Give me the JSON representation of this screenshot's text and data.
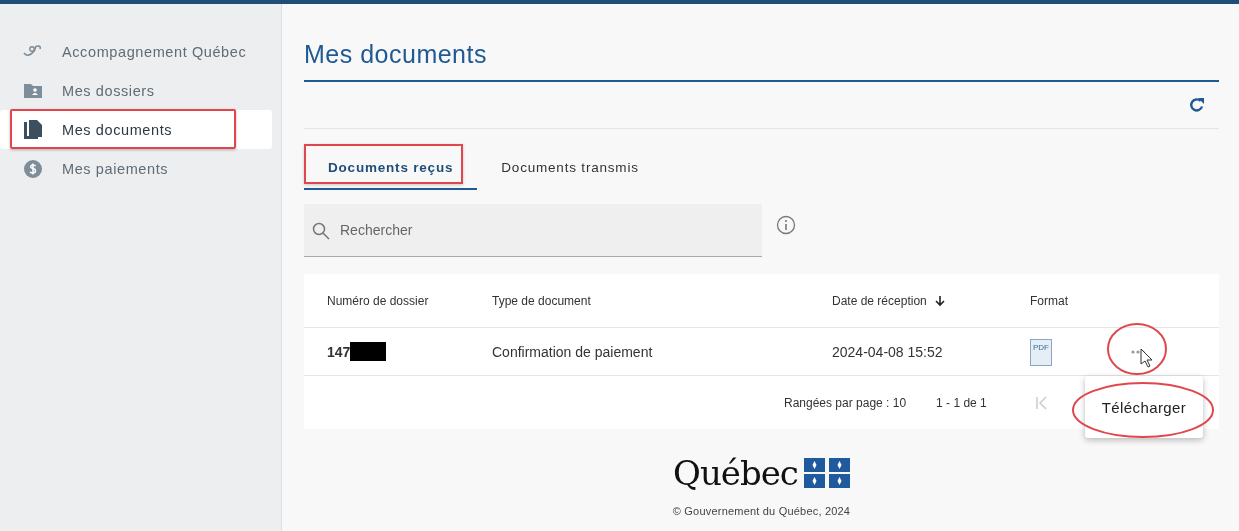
{
  "sidebar": {
    "items": [
      {
        "kind": "support",
        "label": "Accompagnement Québec",
        "selected": false,
        "annotated": false
      },
      {
        "kind": "folder",
        "label": "Mes dossiers",
        "selected": false,
        "annotated": false
      },
      {
        "kind": "documents",
        "label": "Mes documents",
        "selected": true,
        "annotated": true
      },
      {
        "kind": "payment",
        "label": "Mes paiements",
        "selected": false,
        "annotated": false
      }
    ]
  },
  "page_title": "Mes documents",
  "tabs": [
    {
      "label": "Documents reçus",
      "selected": true,
      "annotated": true
    },
    {
      "label": "Documents transmis",
      "selected": false,
      "annotated": false
    }
  ],
  "search": {
    "placeholder": "Rechercher"
  },
  "table": {
    "columns": [
      {
        "label": "Numéro de dossier",
        "sorted": false
      },
      {
        "label": "Type de document",
        "sorted": false
      },
      {
        "label": "Date de réception",
        "sorted": true
      },
      {
        "label": "Format",
        "sorted": false
      }
    ],
    "rows": [
      {
        "dossier": "147",
        "redacted": true,
        "type": "Confirmation de paiement",
        "date": "2024-04-08 15:52",
        "format": "PDF",
        "actions_annotated": true
      }
    ],
    "pagination": {
      "rows_per_page": "Rangées par page : 10",
      "range": "1 - 1 de 1"
    }
  },
  "row_menu": {
    "items": [
      {
        "label": "Télécharger",
        "annotated": true
      }
    ]
  },
  "footer": {
    "logo": "Québec",
    "copyright": "© Gouvernement du Québec, 2024"
  }
}
